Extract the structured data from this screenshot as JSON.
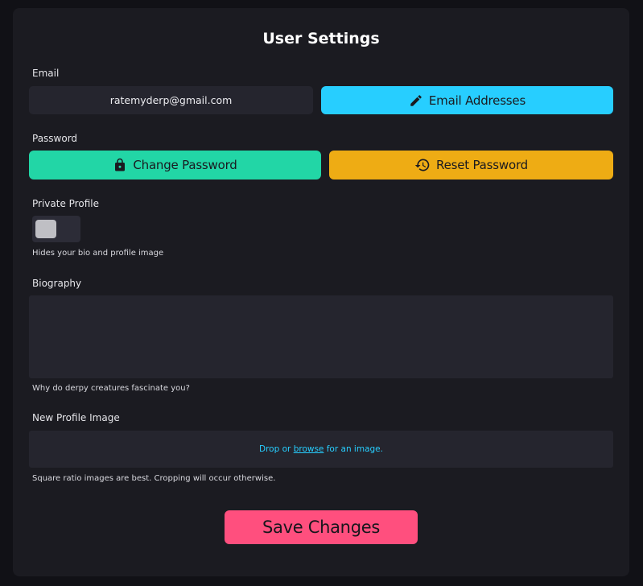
{
  "title": "User Settings",
  "email": {
    "label": "Email",
    "value": "ratemyderp@gmail.com",
    "button_label": "Email Addresses",
    "button_icon": "pencil-icon",
    "button_color": "#27ceff"
  },
  "password": {
    "label": "Password",
    "change_label": "Change Password",
    "change_icon": "lock-icon",
    "change_color": "#22d6a6",
    "reset_label": "Reset Password",
    "reset_icon": "history-icon",
    "reset_color": "#eeac14"
  },
  "private_profile": {
    "label": "Private Profile",
    "enabled": false,
    "hint": "Hides your bio and profile image"
  },
  "biography": {
    "label": "Biography",
    "value": "",
    "hint": "Why do derpy creatures fascinate you?"
  },
  "profile_image": {
    "label": "New Profile Image",
    "drop_prefix": "Drop or",
    "browse_label": "browse",
    "drop_suffix": "for an image.",
    "hint": "Square ratio images are best. Cropping will occur otherwise."
  },
  "save_label": "Save Changes",
  "save_color": "#ff4f7e"
}
